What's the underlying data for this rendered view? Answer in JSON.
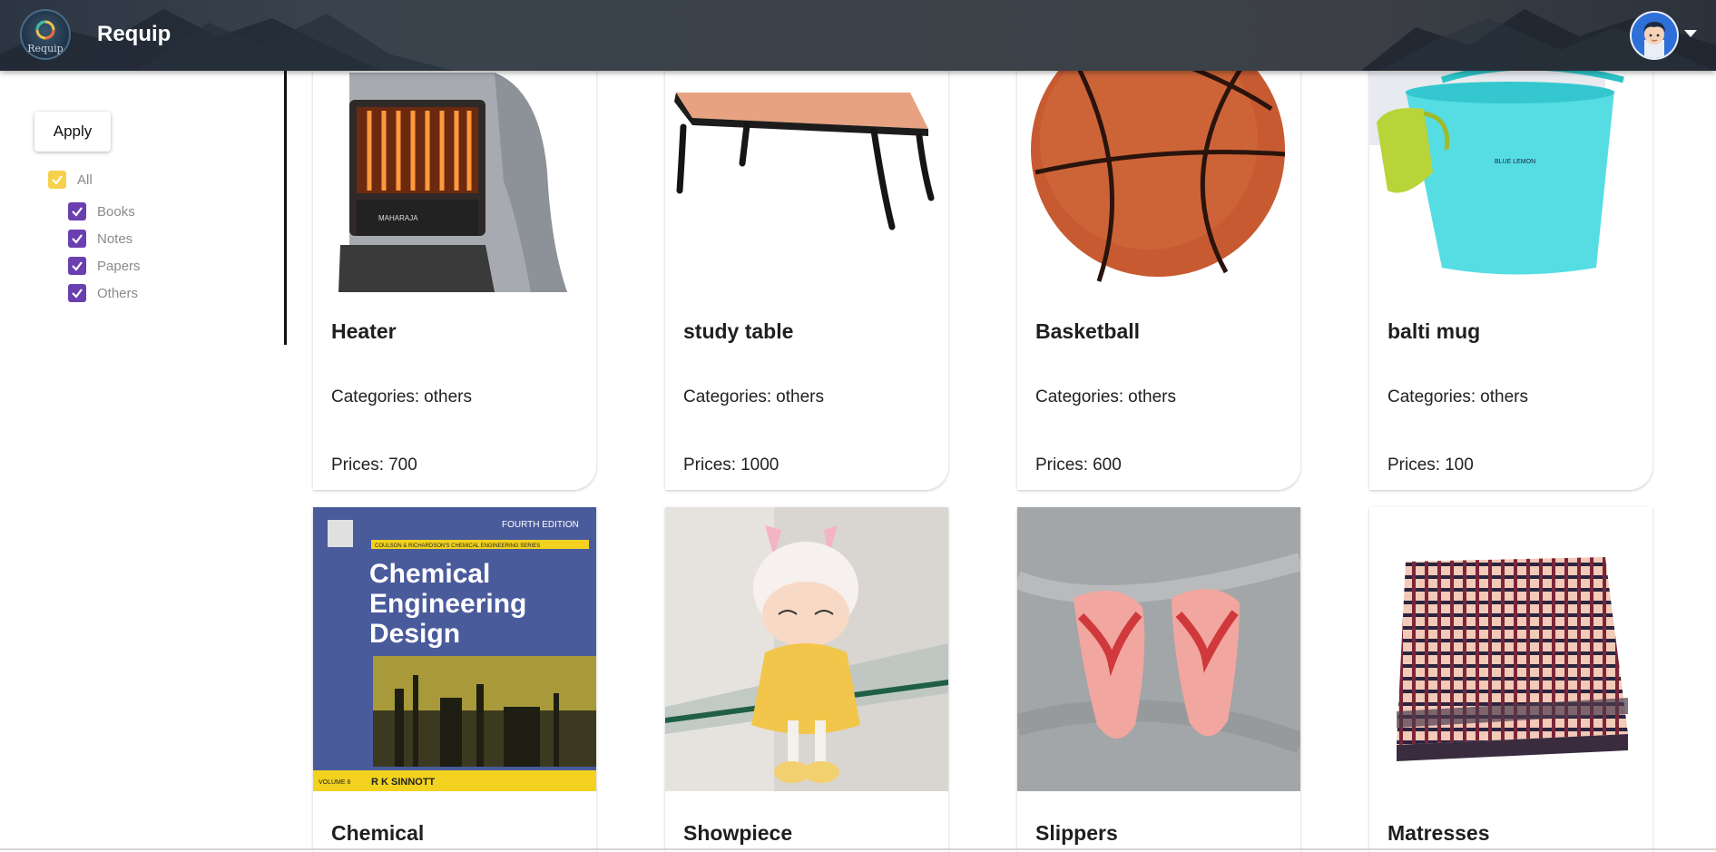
{
  "app": {
    "title": "Requip",
    "logo_text": "Requip"
  },
  "filters": {
    "apply_label": "Apply",
    "all_label": "All",
    "items": [
      {
        "label": "Books"
      },
      {
        "label": "Notes"
      },
      {
        "label": "Papers"
      },
      {
        "label": "Others"
      }
    ]
  },
  "cards_row1": [
    {
      "title": "Heater",
      "categories_label": "Categories:",
      "category": "others",
      "price_label": "Prices:",
      "price": "700"
    },
    {
      "title": "study table",
      "categories_label": "Categories:",
      "category": "others",
      "price_label": "Prices:",
      "price": "1000"
    },
    {
      "title": "Basketball",
      "categories_label": "Categories:",
      "category": "others",
      "price_label": "Prices:",
      "price": "600"
    },
    {
      "title": "balti mug",
      "categories_label": "Categories:",
      "category": "others",
      "price_label": "Prices:",
      "price": "100"
    }
  ],
  "cards_row2": [
    {
      "title": "Chemical"
    },
    {
      "title": "Showpiece"
    },
    {
      "title": "Slippers"
    },
    {
      "title": "Matresses"
    }
  ],
  "book_cover": {
    "edition": "FOURTH EDITION",
    "series": "COULSON & RICHARDSON'S CHEMICAL ENGINEERING SERIES",
    "line1": "Chemical",
    "line2": "Engineering",
    "line3": "Design",
    "author": "R K SINNOTT",
    "volume": "VOLUME 6"
  },
  "bucket_brand": "BLUE LEMON",
  "heater_brand": "MAHARAJA",
  "colors": {
    "accent_purple": "#6a3fb0",
    "accent_yellow": "#f7d14c"
  }
}
